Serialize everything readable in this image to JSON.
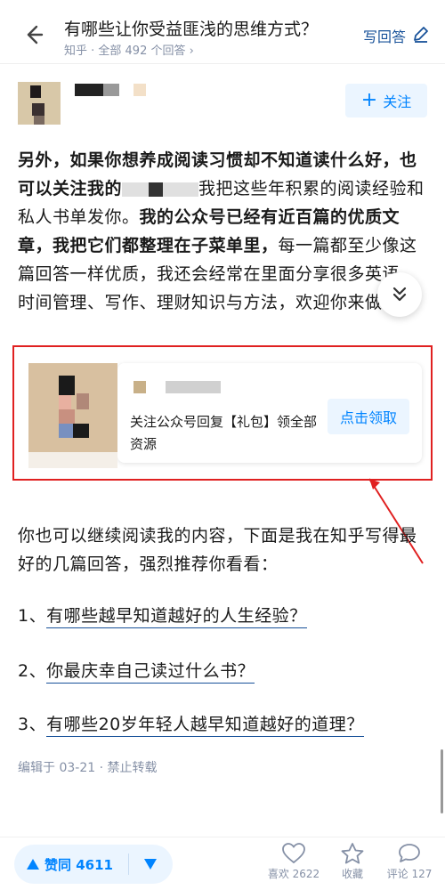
{
  "header": {
    "title": "有哪些让你受益匪浅的思维方式？",
    "meta": "知乎 · 全部 492 个回答",
    "write_answer": "写回答"
  },
  "author": {
    "follow_label": "关注"
  },
  "content": {
    "p1_bold_a": "另外，如果你想养成阅读习惯却不知道读什么好，也可以关注我的",
    "p1_text_a": "我把这些年积累的阅读经验和私人书单发你。",
    "p1_bold_b": "我的公众号已经有近百篇的优质文章，我把它们都整理在子菜单里，",
    "p1_text_b": "每一篇都至少像这篇回答一样优质，我还会经常在里面分享很多英语、时间管理、写作、理财知识与方法，欢迎你来做客。",
    "card_text": "关注公众号回复【礼包】领全部资源",
    "card_button": "点击领取",
    "p2": "你也可以继续阅读我的内容，下面是我在知乎写得最好的几篇回答，强烈推荐你看看：",
    "links": [
      {
        "num": "1、",
        "text": "有哪些越早知道越好的人生经验？"
      },
      {
        "num": "2、",
        "text": "你最庆幸自己读过什么书？"
      },
      {
        "num": "3、",
        "text": "有哪些20岁年轻人越早知道越好的道理？"
      }
    ],
    "edit_meta": "编辑于 03-21 · 禁止转载"
  },
  "bottom": {
    "vote_label": "赞同 4611",
    "like_label": "喜欢 2622",
    "collect_label": "收藏",
    "comment_label": "评论 127"
  },
  "colors": {
    "accent": "#0084ff",
    "link": "#175199",
    "meta": "#8590a6",
    "highlight_frame": "#e02020"
  }
}
